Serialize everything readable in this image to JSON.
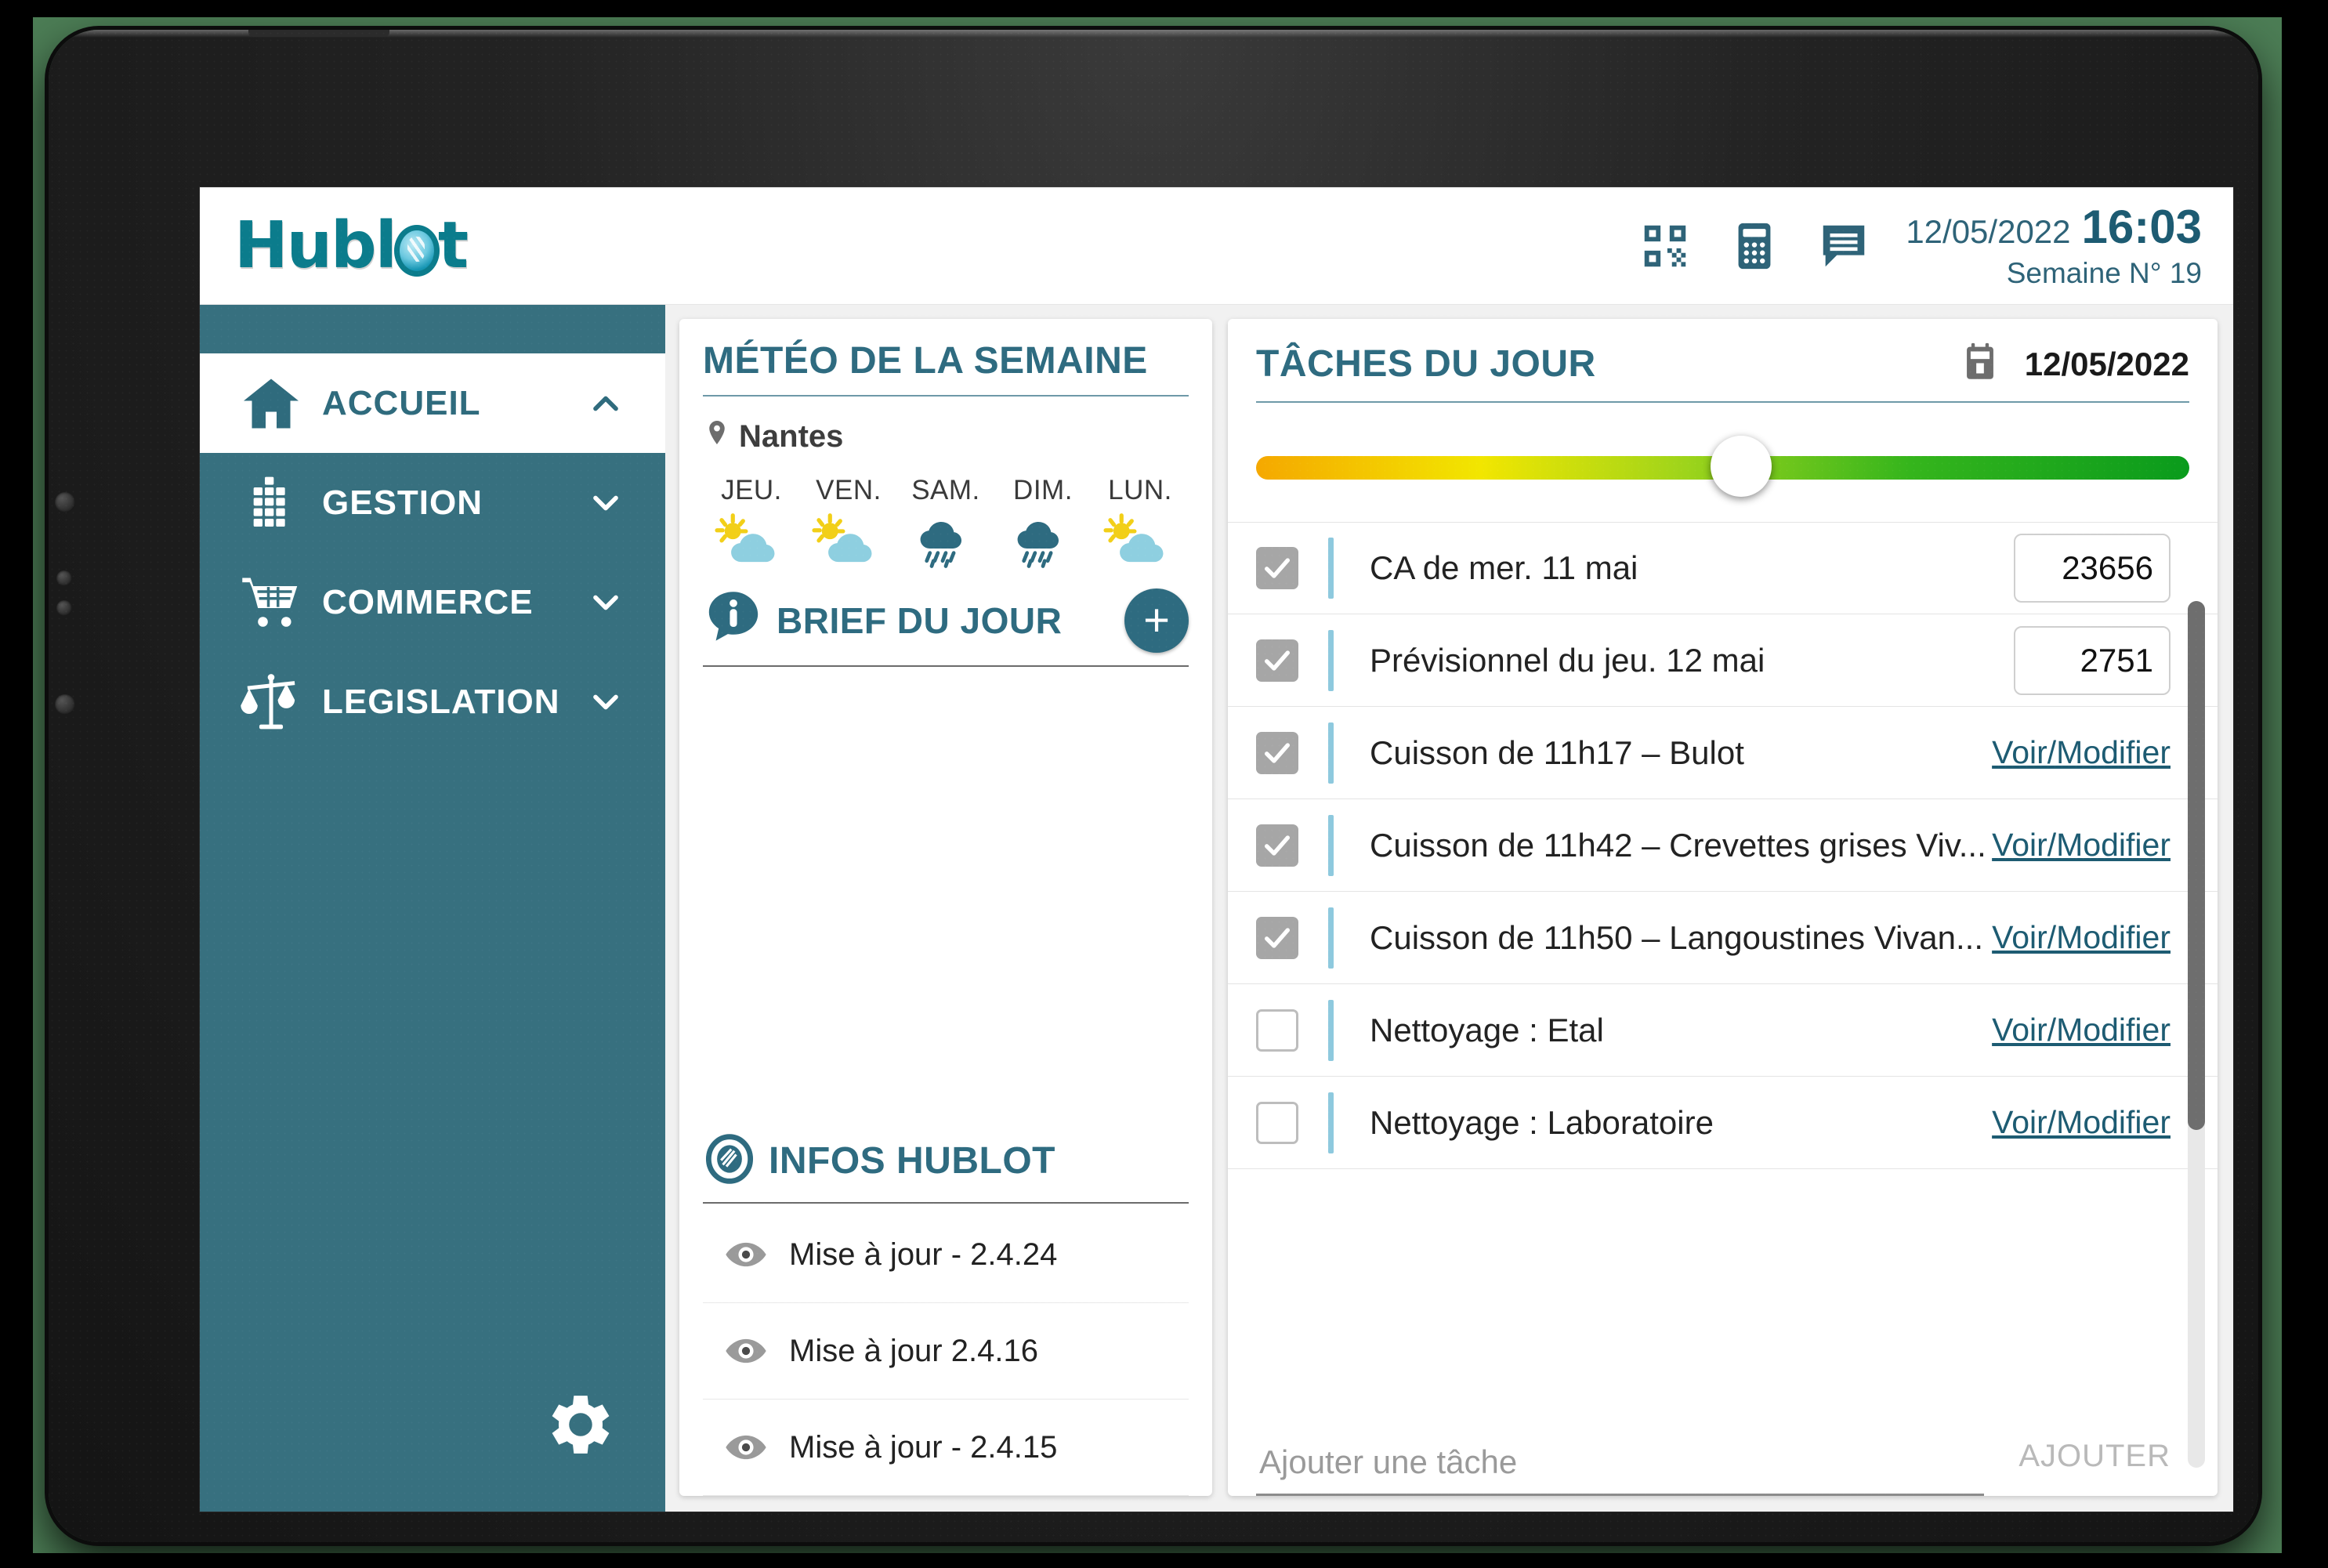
{
  "header": {
    "logo_text_part1": "Hubl",
    "logo_text_part2": "t",
    "icons": [
      "qr-code-icon",
      "calculator-icon",
      "message-icon"
    ],
    "date": "12/05/2022",
    "time": "16:03",
    "week": "Semaine N° 19"
  },
  "sidebar": {
    "items": [
      {
        "label": "ACCUEIL",
        "icon": "home-icon",
        "chevron": "chevron-up-icon",
        "active": true
      },
      {
        "label": "GESTION",
        "icon": "building-icon",
        "chevron": "chevron-down-icon",
        "active": false
      },
      {
        "label": "COMMERCE",
        "icon": "shopping-cart-icon",
        "chevron": "chevron-down-icon",
        "active": false
      },
      {
        "label": "LEGISLATION",
        "icon": "scales-icon",
        "chevron": "chevron-down-icon",
        "active": false
      }
    ],
    "settings_icon": "gear-icon"
  },
  "weather": {
    "title": "MÉTÉO DE LA SEMAINE",
    "city": "Nantes",
    "city_icon": "location-pin-icon",
    "days": [
      {
        "label": "JEU.",
        "icon": "sun-cloud-icon"
      },
      {
        "label": "VEN.",
        "icon": "sun-cloud-icon"
      },
      {
        "label": "SAM.",
        "icon": "rain-cloud-icon"
      },
      {
        "label": "DIM.",
        "icon": "rain-cloud-icon"
      },
      {
        "label": "LUN.",
        "icon": "sun-cloud-icon"
      }
    ]
  },
  "brief": {
    "title": "BRIEF DU JOUR",
    "icon": "info-bubble-icon",
    "add_label": "+"
  },
  "infos": {
    "title": "INFOS HUBLOT",
    "icon": "hublot-logo-icon",
    "items": [
      {
        "label": "Mise à jour - 2.4.24",
        "icon": "eye-icon"
      },
      {
        "label": "Mise à jour 2.4.16",
        "icon": "eye-icon"
      },
      {
        "label": "Mise à jour - 2.4.15",
        "icon": "eye-icon"
      }
    ]
  },
  "tasks": {
    "title": "TÂCHES DU JOUR",
    "calendar_icon": "calendar-icon",
    "date": "12/05/2022",
    "progress_percent": 52,
    "rows": [
      {
        "label": "CA de mer. 11 mai",
        "checked": true,
        "value": "23656",
        "type": "value"
      },
      {
        "label": "Prévisionnel du jeu. 12 mai",
        "checked": true,
        "value": "2751",
        "type": "value"
      },
      {
        "label": "Cuisson de 11h17 – Bulot",
        "checked": true,
        "value": "Voir/Modifier",
        "type": "link"
      },
      {
        "label": "Cuisson de 11h42 – Crevettes grises Viv...",
        "checked": true,
        "value": "Voir/Modifier",
        "type": "link"
      },
      {
        "label": "Cuisson de 11h50 – Langoustines Vivan...",
        "checked": true,
        "value": "Voir/Modifier",
        "type": "link"
      },
      {
        "label": "Nettoyage : Etal",
        "checked": false,
        "value": "Voir/Modifier",
        "type": "link"
      },
      {
        "label": "Nettoyage : Laboratoire",
        "checked": false,
        "value": "Voir/Modifier",
        "type": "link"
      }
    ],
    "add_placeholder": "Ajouter une tâche",
    "add_button": "AJOUTER"
  },
  "colors": {
    "brand_teal": "#37707f",
    "brand_dark_teal": "#2e6b80",
    "logo_teal": "#0b7c8c",
    "link_teal": "#1d5b72",
    "task_bar": "#8ec9de",
    "checkbox_on": "#a6a6a6"
  }
}
